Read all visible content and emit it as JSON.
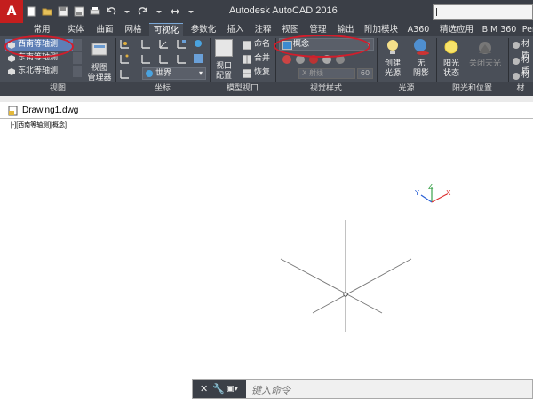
{
  "app": {
    "logo": "A",
    "title": "Autodesk AutoCAD 2016"
  },
  "tabs": [
    {
      "label": "常用",
      "x": 0,
      "w": 0
    },
    {
      "label": "实体"
    },
    {
      "label": "曲面"
    },
    {
      "label": "网格"
    },
    {
      "label": "可视化"
    },
    {
      "label": "参数化"
    },
    {
      "label": "插入"
    },
    {
      "label": "注释"
    },
    {
      "label": "视图"
    },
    {
      "label": "管理"
    },
    {
      "label": "输出"
    },
    {
      "label": "附加模块"
    },
    {
      "label": "A360"
    },
    {
      "label": "精选应用"
    },
    {
      "label": "BIM 360"
    },
    {
      "label": "Perf"
    }
  ],
  "active_tab": "可视化",
  "view_panel": {
    "items": [
      "西南等轴测",
      "东南等轴测",
      "东北等轴测"
    ],
    "selected": "西南等轴测",
    "manager_label": "视图\n管理器",
    "manager_line1": "视图",
    "manager_line2": "管理器"
  },
  "coords_panel": {
    "world": "世界"
  },
  "viewport_panel": {
    "config_line1": "视口",
    "config_line2": "配置",
    "named": "命名",
    "join": "合并",
    "restore": "恢复"
  },
  "visual_styles": {
    "current": "概念",
    "field_placeholder": "X 射线",
    "field_value": "60"
  },
  "lights": {
    "create_line1": "创建",
    "create_line2": "光源",
    "shadow_line1": "无",
    "shadow_line2": "阴影"
  },
  "sun": {
    "status_line1": "阳光",
    "status_line2": "状态",
    "off_label": "关闭天光"
  },
  "materials": [
    "材质",
    "材质",
    "材质"
  ],
  "panel_titles": {
    "view": "视图",
    "coords": "坐标",
    "model_viewports": "模型视口",
    "visual_styles": "视觉样式",
    "lights": "光源",
    "sun_location": "阳光和位置",
    "materials": "材"
  },
  "document": {
    "tab": "Drawing1.dwg",
    "viewport_label": "[-][西南等轴测][概念]"
  },
  "ucs": {
    "x": "X",
    "y": "Y",
    "z": "Z"
  },
  "command": {
    "prompt": "键入命令"
  },
  "colors": {
    "ribbon_bg": "#4a4f58",
    "title_bg": "#3b3f47",
    "highlight": "#d21d2b",
    "selection": "#5e7fb6"
  }
}
